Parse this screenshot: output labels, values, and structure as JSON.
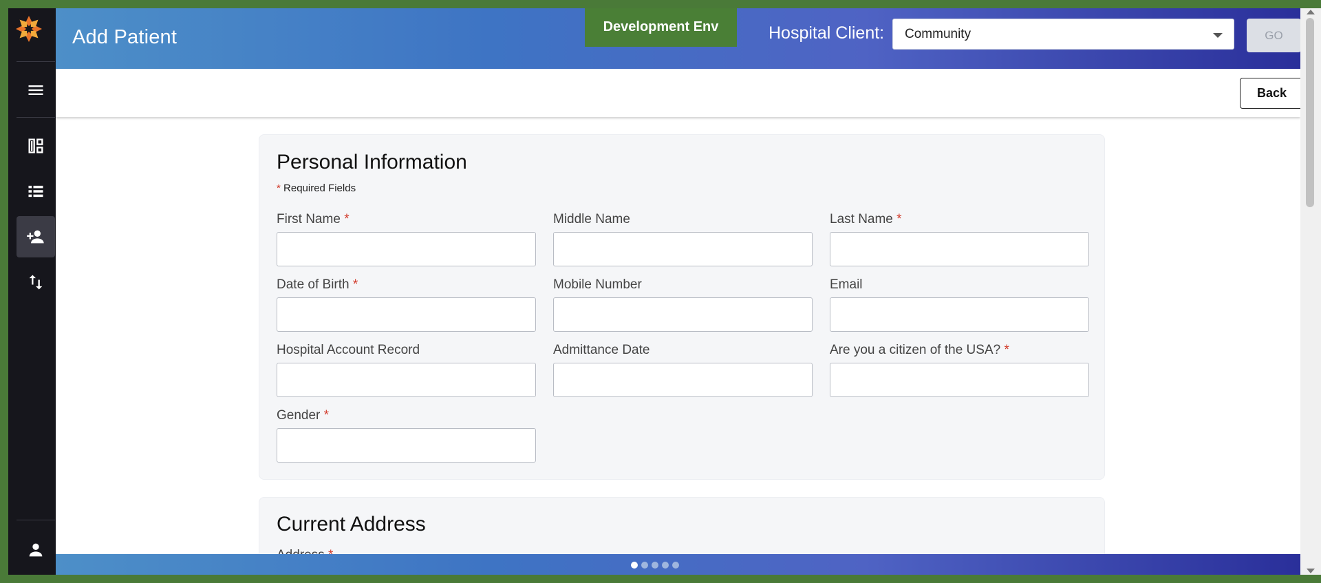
{
  "header": {
    "page_title": "Add Patient",
    "env_badge": "Development Env",
    "client_label": "Hospital Client:",
    "client_value": "Community",
    "go_label": "GO",
    "gradient_colors": [
      "#4d8fc8",
      "#3e74c4",
      "#4f63c4",
      "#2a2f9a"
    ]
  },
  "sidebar": {
    "items": [
      {
        "icon": "menu-icon"
      },
      {
        "icon": "dashboard-icon"
      },
      {
        "icon": "list-icon"
      },
      {
        "icon": "add-person-icon",
        "active": true
      },
      {
        "icon": "transfer-arrows-icon"
      },
      {
        "icon": "user-profile-icon"
      }
    ]
  },
  "toolbar": {
    "back_label": "Back"
  },
  "personal": {
    "title": "Personal Information",
    "required_note": "Required Fields",
    "required_star": "*",
    "fields": [
      {
        "label": "First Name",
        "required": true,
        "value": ""
      },
      {
        "label": "Middle Name",
        "required": false,
        "value": ""
      },
      {
        "label": "Last Name",
        "required": true,
        "value": ""
      },
      {
        "label": "Date of Birth",
        "required": true,
        "value": ""
      },
      {
        "label": "Mobile Number",
        "required": false,
        "value": ""
      },
      {
        "label": "Email",
        "required": false,
        "value": ""
      },
      {
        "label": "Hospital Account Record",
        "required": false,
        "value": ""
      },
      {
        "label": "Admittance Date",
        "required": false,
        "value": ""
      },
      {
        "label": "Are you a citizen of the USA?",
        "required": true,
        "value": ""
      },
      {
        "label": "Gender",
        "required": true,
        "value": ""
      }
    ]
  },
  "address": {
    "title": "Current Address",
    "first_field_label": "Address"
  },
  "pager": {
    "count": 5,
    "active": 0
  },
  "colors": {
    "env_badge": "#4a7f36",
    "required": "#d23a2a",
    "sidebar": "#16161c"
  }
}
